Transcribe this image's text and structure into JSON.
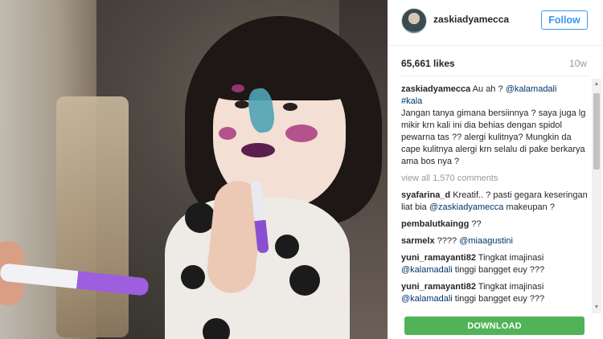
{
  "post": {
    "username": "zaskiadyamecca",
    "follow_label": "Follow",
    "likes": "65,661 likes",
    "age": "10w",
    "caption": {
      "user": "zaskiadyamecca",
      "text_1": " Au ah ",
      "emoji_1": "?",
      "mention": "@kalamadali",
      "hashtag": "#kala",
      "body": "Jangan tanya gimana bersiinnya ? saya juga lg mikir krn kali ini dia behias dengan spidol pewarna tas ?? alergi kulitnya? Mungkin da cape kulitnya alergi krn selalu di pake berkarya ama bos nya ?"
    },
    "view_all": "view all 1,570 comments",
    "comments": [
      {
        "user": "syafarina_d",
        "text": " Kreatif.. ? pasti gegara keseringan liat bia ",
        "mention": "@zaskiadyamecca",
        "text_after": " makeupan ?"
      },
      {
        "user": "pembalutkaingg",
        "text": " ??",
        "mention": "",
        "text_after": ""
      },
      {
        "user": "sarmelx",
        "text": " ???? ",
        "mention": "@miaagustini",
        "text_after": ""
      },
      {
        "user": "yuni_ramayanti82",
        "text": " Tingkat imajinasi ",
        "mention": "@kalamadali",
        "text_after": " tinggi bangget euy ???"
      },
      {
        "user": "yuni_ramayanti82",
        "text": " Tingkat imajinasi ",
        "mention": "@kalamadali",
        "text_after": " tinggi bangget euy ???"
      }
    ]
  },
  "download_label": "DOWNLOAD",
  "colors": {
    "accent": "#3897f0",
    "download": "#51b357",
    "mention": "#003569"
  }
}
